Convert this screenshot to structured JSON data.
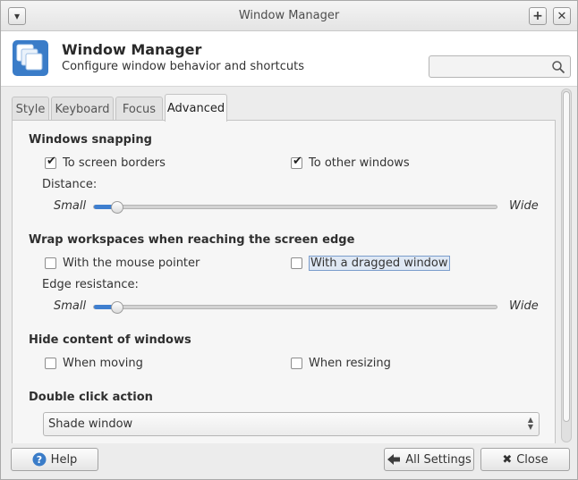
{
  "window": {
    "title": "Window Manager"
  },
  "header": {
    "title": "Window Manager",
    "subtitle": "Configure window behavior and shortcuts",
    "search_placeholder": "",
    "search_value": ""
  },
  "tabs": [
    {
      "label": "Style",
      "active": false
    },
    {
      "label": "Keyboard",
      "active": false
    },
    {
      "label": "Focus",
      "active": false
    },
    {
      "label": "Advanced",
      "active": true
    }
  ],
  "snapping": {
    "title": "Windows snapping",
    "to_screen_borders": {
      "label": "To screen borders",
      "checked": true
    },
    "to_other_windows": {
      "label": "To other windows",
      "checked": true
    },
    "distance_label": "Distance:",
    "min_label": "Small",
    "max_label": "Wide",
    "value_fraction": 0.06
  },
  "wrap": {
    "title": "Wrap workspaces when reaching the screen edge",
    "mouse_pointer": {
      "label": "With the mouse pointer",
      "checked": false
    },
    "dragged_window": {
      "label": "With a dragged window",
      "checked": false
    },
    "resistance_label": "Edge resistance:",
    "min_label": "Small",
    "max_label": "Wide",
    "value_fraction": 0.06
  },
  "hide": {
    "title": "Hide content of windows",
    "when_moving": {
      "label": "When moving",
      "checked": false
    },
    "when_resizing": {
      "label": "When resizing",
      "checked": false
    }
  },
  "double_click": {
    "title": "Double click action",
    "selected": "Shade window"
  },
  "buttons": {
    "help": "Help",
    "all_settings": "All Settings",
    "close": "Close"
  },
  "colors": {
    "accent": "#3f7fcf",
    "window_bg": "#ececec",
    "panel_bg": "#f6f6f6"
  },
  "icons": {
    "window_menu": "chevron-down-icon",
    "maximize": "plus-icon",
    "close": "close-icon",
    "app": "window-manager-icon",
    "search": "search-icon",
    "help": "help-icon",
    "all_settings": "arrow-left-icon",
    "close_button": "x-icon"
  }
}
